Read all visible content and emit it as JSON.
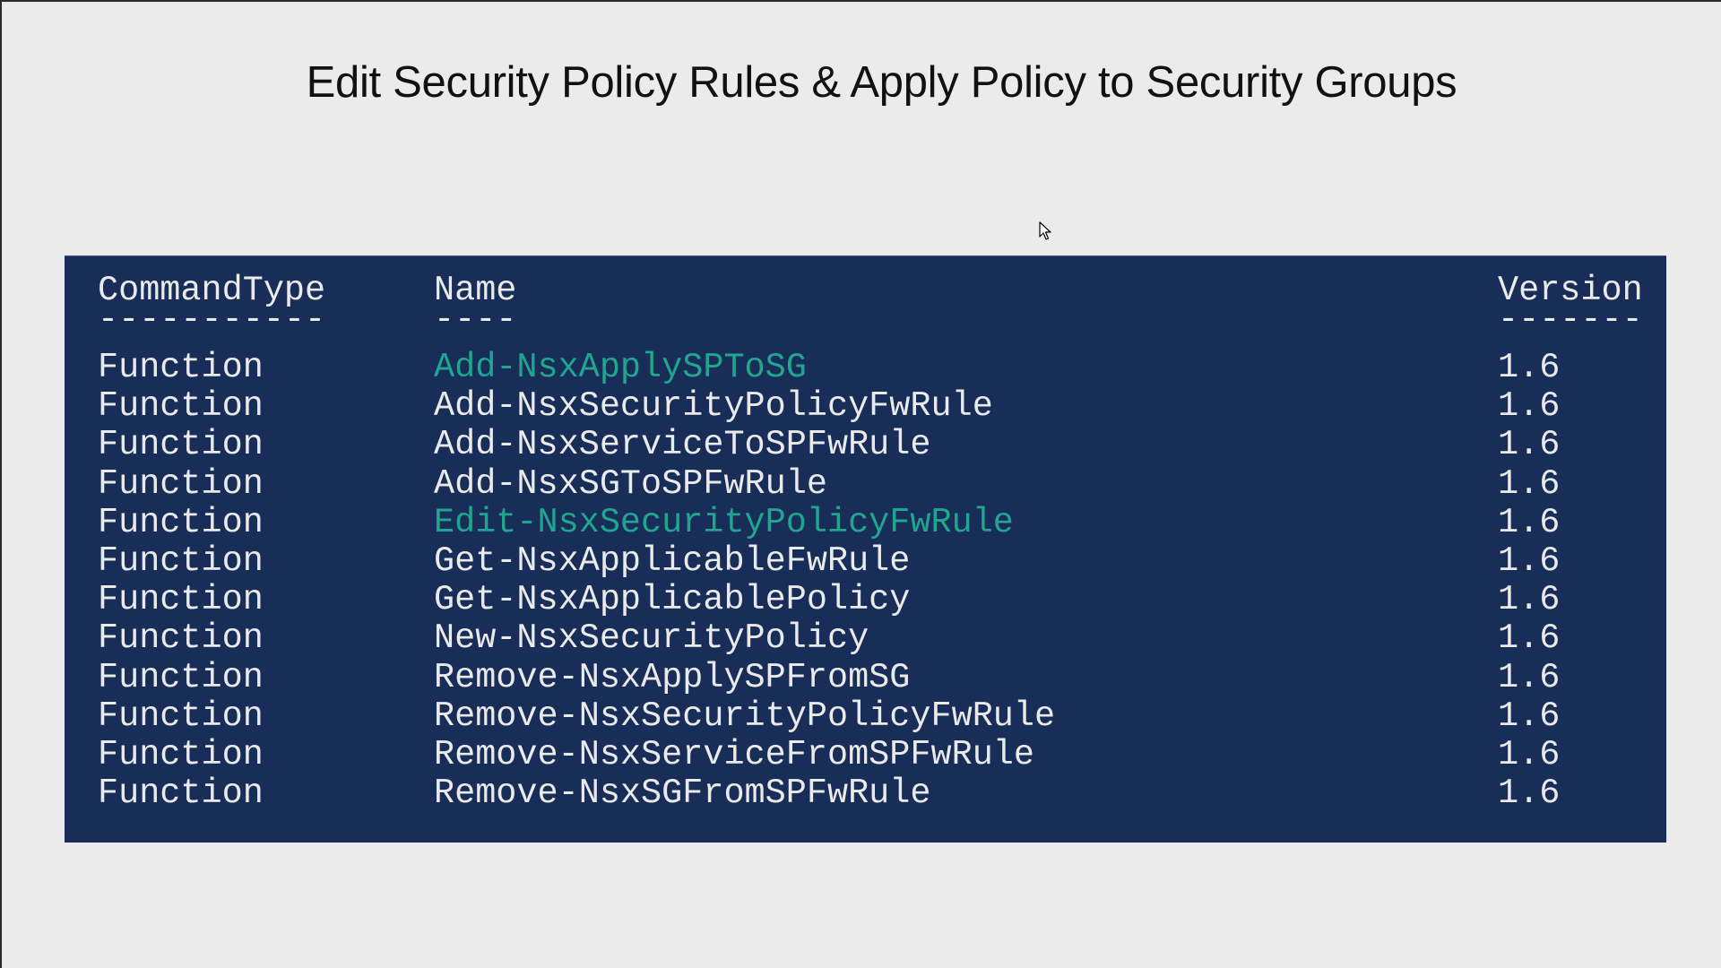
{
  "slide": {
    "title": "Edit Security Policy Rules & Apply Policy to Security Groups"
  },
  "cursor": {
    "icon": "mouse-pointer-icon"
  },
  "console": {
    "highlight_color": "#20a68f",
    "background_color": "#182d58",
    "text_color": "#eaeaea",
    "headers": {
      "command_type": "CommandType",
      "name": "Name",
      "version": "Version"
    },
    "underlines": {
      "command_type": "-----------",
      "name": "----",
      "version": "-------"
    },
    "rows": [
      {
        "command_type": "Function",
        "name": "Add-NsxApplySPToSG",
        "version": "1.6",
        "highlighted": true
      },
      {
        "command_type": "Function",
        "name": "Add-NsxSecurityPolicyFwRule",
        "version": "1.6",
        "highlighted": false
      },
      {
        "command_type": "Function",
        "name": "Add-NsxServiceToSPFwRule",
        "version": "1.6",
        "highlighted": false
      },
      {
        "command_type": "Function",
        "name": "Add-NsxSGToSPFwRule",
        "version": "1.6",
        "highlighted": false
      },
      {
        "command_type": "Function",
        "name": "Edit-NsxSecurityPolicyFwRule",
        "version": "1.6",
        "highlighted": true
      },
      {
        "command_type": "Function",
        "name": "Get-NsxApplicableFwRule",
        "version": "1.6",
        "highlighted": false
      },
      {
        "command_type": "Function",
        "name": "Get-NsxApplicablePolicy",
        "version": "1.6",
        "highlighted": false
      },
      {
        "command_type": "Function",
        "name": "New-NsxSecurityPolicy",
        "version": "1.6",
        "highlighted": false
      },
      {
        "command_type": "Function",
        "name": "Remove-NsxApplySPFromSG",
        "version": "1.6",
        "highlighted": false
      },
      {
        "command_type": "Function",
        "name": "Remove-NsxSecurityPolicyFwRule",
        "version": "1.6",
        "highlighted": false
      },
      {
        "command_type": "Function",
        "name": "Remove-NsxServiceFromSPFwRule",
        "version": "1.6",
        "highlighted": false
      },
      {
        "command_type": "Function",
        "name": "Remove-NsxSGFromSPFwRule",
        "version": "1.6",
        "highlighted": false
      }
    ]
  }
}
